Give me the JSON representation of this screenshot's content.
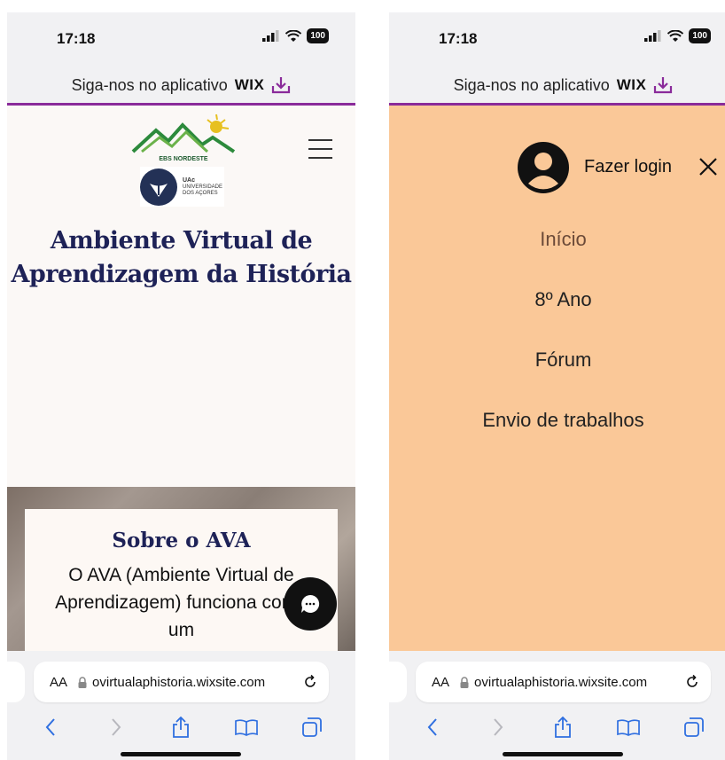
{
  "status_bar": {
    "time": "17:18",
    "battery": "100"
  },
  "banner": {
    "text": "Siga-nos no aplicativo",
    "brand": "WIX"
  },
  "left_page": {
    "logo_ebs_label": "EBS NORDESTE",
    "logo_uac": {
      "short": "UAc",
      "line1": "UNIVERSIDADE",
      "line2": "DOS AÇORES"
    },
    "title_line1": "Ambiente Virtual de",
    "title_line2": "Aprendizagem da História",
    "about": {
      "heading": "Sobre o AVA",
      "text": "O AVA (Ambiente Virtual de Aprendizagem) funciona como um"
    }
  },
  "right_page": {
    "login_label": "Fazer login",
    "nav": [
      {
        "label": "Início"
      },
      {
        "label": "8º Ano"
      },
      {
        "label": "Fórum"
      },
      {
        "label": "Envio de trabalhos"
      }
    ]
  },
  "safari": {
    "aa_label": "AA",
    "url": "ovirtualaphistoria.wixsite.com"
  },
  "colors": {
    "title": "#1e2257",
    "banner_line": "#8a2b9a",
    "menu_bg": "#fac898",
    "page_bg": "#fbf8f6",
    "wix_download": "#8a2b9a"
  }
}
